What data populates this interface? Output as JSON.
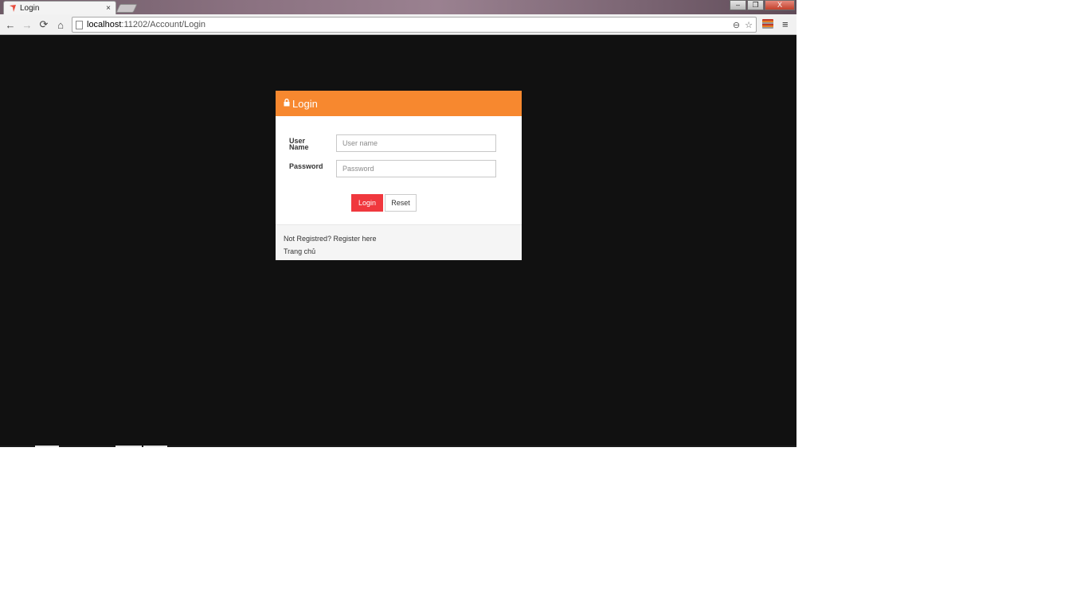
{
  "browser": {
    "tab_title": "Login",
    "tab_close": "×",
    "window_controls": {
      "minimize": "–",
      "maximize": "❐",
      "close": "X"
    },
    "nav": {
      "back": "←",
      "forward": "→",
      "reload": "⟳",
      "home": "⌂"
    },
    "url_host": "localhost",
    "url_rest": ":11202/Account/Login",
    "omnibox_icons": [
      "zoom-icon",
      "star-icon"
    ],
    "menu": "≡",
    "colors": {
      "titlebar": "#7b6573",
      "toolbar": "#f1f1f1"
    }
  },
  "page": {
    "background": "#111111",
    "login": {
      "title": "Login",
      "heading_color": "#f7882f",
      "username_label_line1": "User",
      "username_label_line2": "Name",
      "username_placeholder": "User name",
      "password_label": "Password",
      "password_placeholder": "Password",
      "login_button": "Login",
      "login_button_color": "#f0383e",
      "reset_button": "Reset",
      "footer_prefix": "Not Registred? ",
      "register_link": "Register here",
      "home_link": "Trang chủ"
    }
  }
}
